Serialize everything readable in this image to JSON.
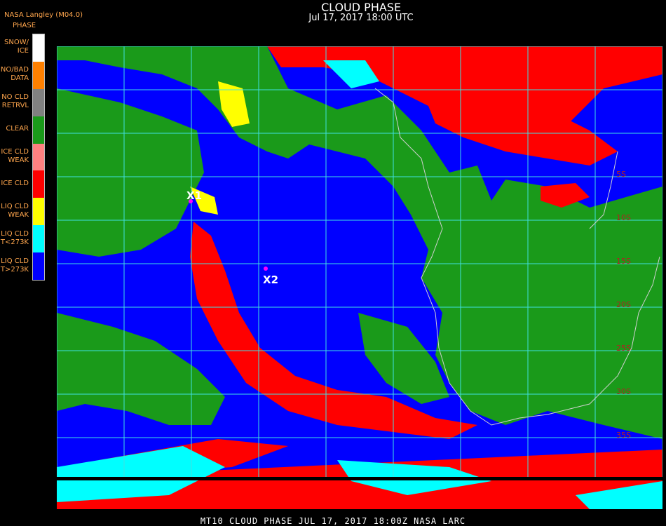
{
  "header": {
    "credit": "NASA Langley (M04.0)",
    "title": "CLOUD PHASE",
    "subtitle": "Jul 17, 2017 18:00 UTC"
  },
  "legend": {
    "title": "PHASE",
    "items": [
      {
        "label": "SNOW/\nICE",
        "color": "#ffffff"
      },
      {
        "label": "NO/BAD\nDATA",
        "color": "#ff8000"
      },
      {
        "label": "NO CLD\nRETRVL",
        "color": "#808080"
      },
      {
        "label": "CLEAR",
        "color": "#1a9a1a"
      },
      {
        "label": "ICE CLD\nWEAK",
        "color": "#ff8080"
      },
      {
        "label": "ICE CLD",
        "color": "#ff0000"
      },
      {
        "label": "LIQ CLD\nWEAK",
        "color": "#ffff00"
      },
      {
        "label": "LIQ CLD\nT<273K",
        "color": "#00ffff"
      },
      {
        "label": "LIQ CLD\nT>273K",
        "color": "#0000ff"
      }
    ]
  },
  "markers": [
    {
      "label": "X1"
    },
    {
      "label": "X2"
    }
  ],
  "lat_labels": [
    "5S",
    "10S",
    "15S",
    "20S",
    "25S",
    "30S",
    "35S"
  ],
  "footer": "MT10  CLOUD PHASE   JUL 17, 2017 18:00Z   NASA LARC"
}
